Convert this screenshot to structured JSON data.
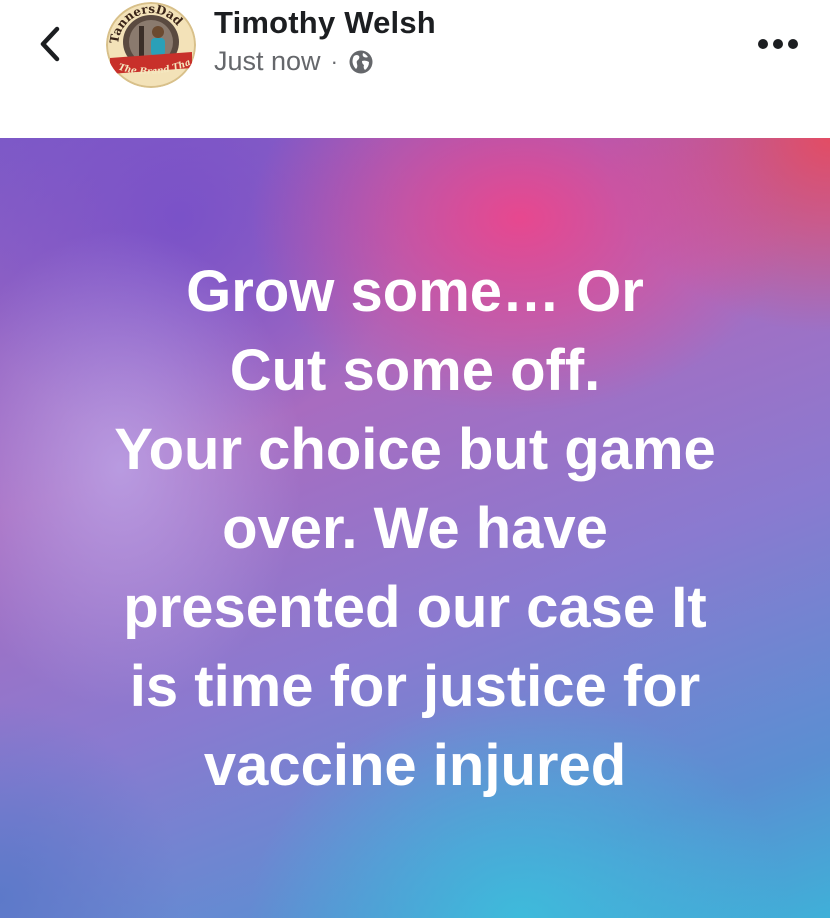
{
  "header": {
    "author": "Timothy Welsh",
    "timestamp": "Just now",
    "separator": "·",
    "audience_icon": "globe-icon",
    "back_icon": "chevron-left-icon",
    "more_icon": "more-horizontal-icon"
  },
  "avatar": {
    "badge_text_top": "TannersDad",
    "badge_text_bottom": "The Brand That Cares"
  },
  "post": {
    "text": "Grow some… Or\nCut some off.\nYour choice but game\nover. We have\npresented our case It\nis time for justice for\nvaccine injured",
    "text_color": "#ffffff"
  },
  "colors": {
    "author": "#1c1e21",
    "meta": "#65676b"
  }
}
